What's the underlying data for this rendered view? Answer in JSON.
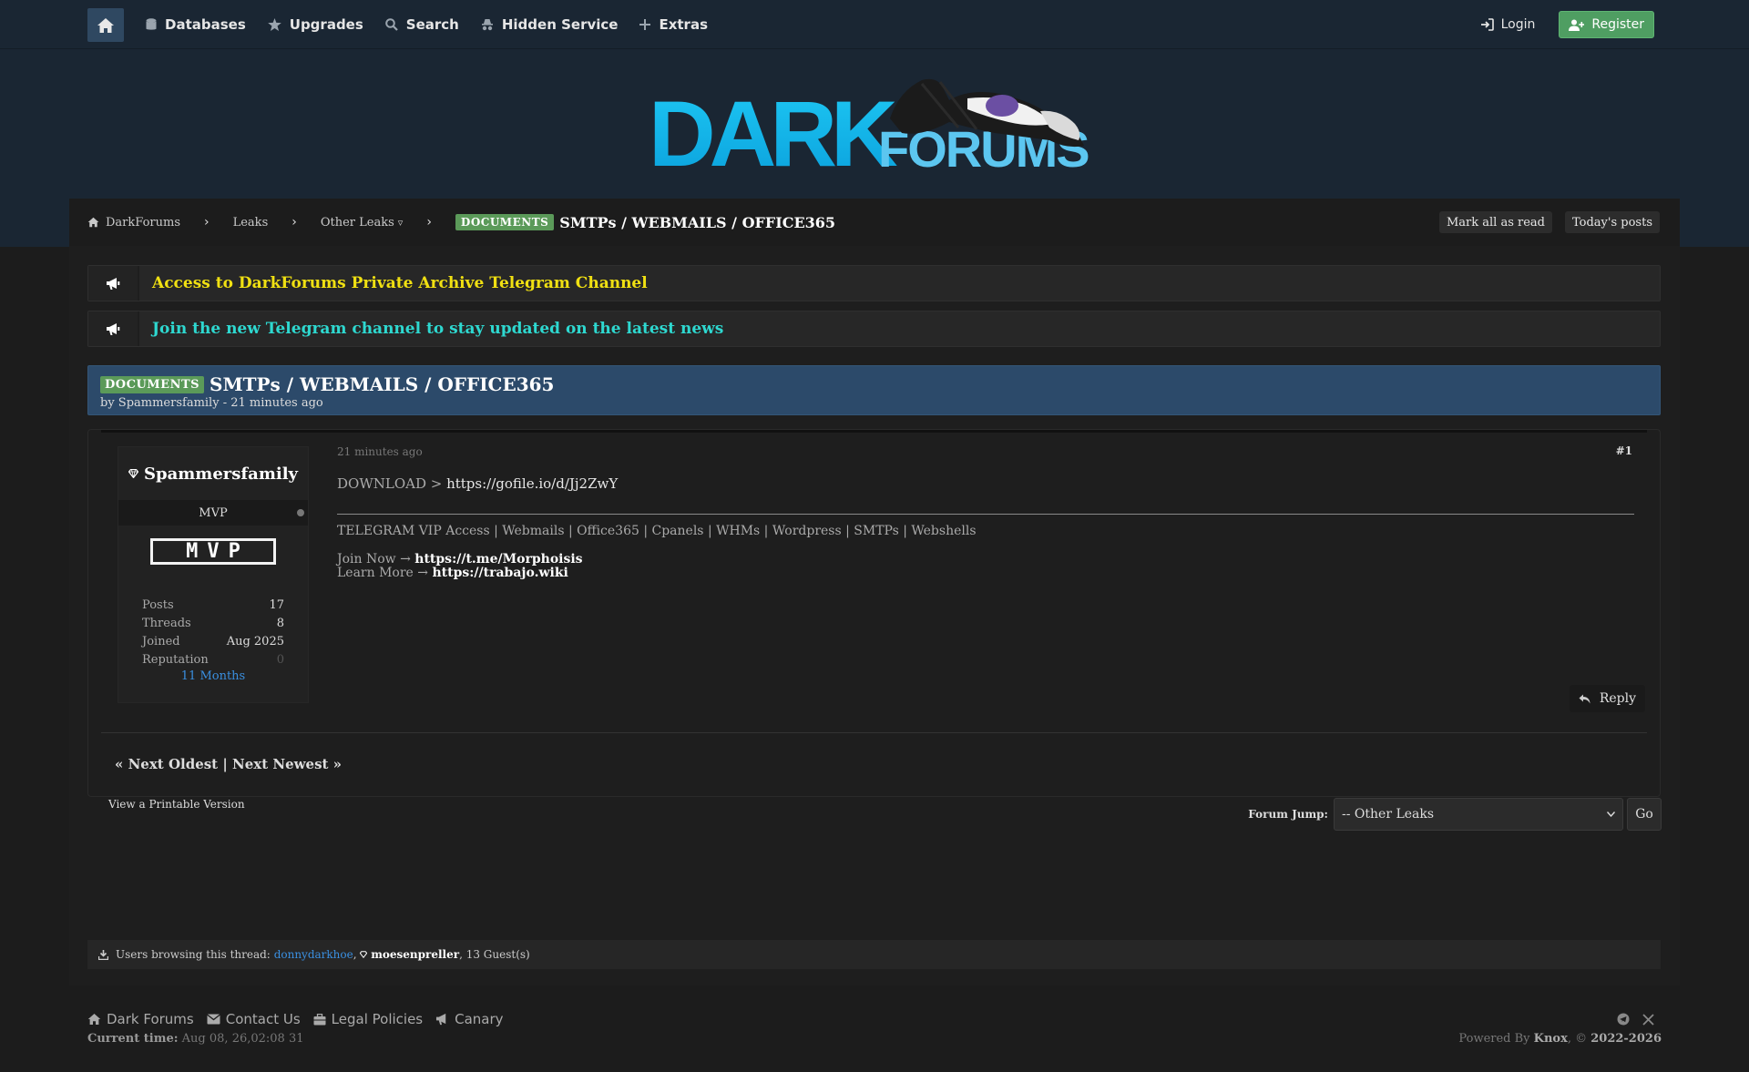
{
  "nav": {
    "items": [
      {
        "label": "Databases",
        "icon": "database-icon"
      },
      {
        "label": "Upgrades",
        "icon": "star-icon"
      },
      {
        "label": "Search",
        "icon": "search-icon"
      },
      {
        "label": "Hidden Service",
        "icon": "incognito-icon"
      },
      {
        "label": "Extras",
        "icon": "plus-icon"
      }
    ],
    "login_label": "Login",
    "register_label": "Register"
  },
  "logo": {
    "word1": "DARK",
    "word2": "FORUMS"
  },
  "breadcrumb": {
    "home": "DarkForums",
    "level1": "Leaks",
    "level2": "Other Leaks",
    "level2_caret": "▿",
    "prefix": "DOCUMENTS",
    "current": "SMTPs / WEBMAILS / OFFICE365"
  },
  "buttons": {
    "mark_read": "Mark all as read",
    "todays_posts": "Today's posts"
  },
  "announcements": [
    {
      "text": "Access to DarkForums Private Archive Telegram Channel",
      "color": "#f0e012"
    },
    {
      "text": "Join the new Telegram channel to stay updated on the latest news",
      "color": "#2ed8d0"
    }
  ],
  "thread": {
    "prefix": "DOCUMENTS",
    "title": "SMTPs / WEBMAILS / OFFICE365",
    "byline": "by Spammersfamily - 21 minutes ago"
  },
  "author": {
    "name": "Spammersfamily",
    "rank": "MVP",
    "badge": "MVP",
    "stats": [
      {
        "k": "Posts",
        "v": "17"
      },
      {
        "k": "Threads",
        "v": "8"
      },
      {
        "k": "Joined",
        "v": "Aug 2025"
      },
      {
        "k": "Reputation",
        "v": "0"
      }
    ],
    "age": "11 Months"
  },
  "post": {
    "time": "21 minutes ago",
    "number": "#1",
    "download_prefix": "DOWNLOAD > ",
    "download_url": "https://gofile.io/d/Jj2ZwY",
    "signature": "TELEGRAM VIP Access | Webmails | Office365 | Cpanels | WHMs | Wordpress | SMTPs | Webshells",
    "join_label": "Join Now → ",
    "join_link": "https://t.me/Morphoisis",
    "learn_label": "Learn More → ",
    "learn_link": "https://trabajo.wiki",
    "reply_label": "Reply"
  },
  "pagination": {
    "text": "« Next Oldest | Next Newest »"
  },
  "printable": "View a Printable Version",
  "forum_jump": {
    "label": "Forum Jump:",
    "selected": "-- Other Leaks",
    "go": "Go"
  },
  "browsing": {
    "prefix": "Users browsing this thread:",
    "user1": "donnydarkhoe",
    "user2": "moesenpreller",
    "suffix": ", 13 Guest(s)"
  },
  "footer": {
    "links": [
      {
        "label": "Dark Forums",
        "icon": "home-icon"
      },
      {
        "label": "Contact Us",
        "icon": "envelope-icon"
      },
      {
        "label": "Legal Policies",
        "icon": "briefcase-icon"
      },
      {
        "label": "Canary",
        "icon": "megaphone-icon"
      }
    ],
    "time_label": "Current time:",
    "time_value": "Aug 08, 26,02:08 31",
    "powered_prefix": "Powered By ",
    "powered_name": "Knox",
    "powered_mid": ", © ",
    "powered_years": "2022-2026"
  }
}
